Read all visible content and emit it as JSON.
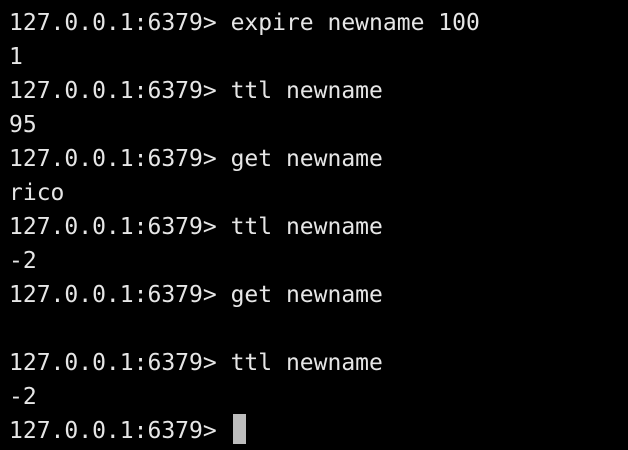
{
  "terminal": {
    "prompt": "127.0.0.1:6379> ",
    "lines": [
      {
        "type": "command",
        "text": "expire newname 100"
      },
      {
        "type": "output",
        "text": "1"
      },
      {
        "type": "command",
        "text": "ttl newname"
      },
      {
        "type": "output",
        "text": "95"
      },
      {
        "type": "command",
        "text": "get newname"
      },
      {
        "type": "output",
        "text": "rico"
      },
      {
        "type": "command",
        "text": "ttl newname"
      },
      {
        "type": "output",
        "text": "-2"
      },
      {
        "type": "command",
        "text": "get newname"
      },
      {
        "type": "output",
        "text": ""
      },
      {
        "type": "command",
        "text": "ttl newname"
      },
      {
        "type": "output",
        "text": "-2"
      }
    ],
    "current_input": ""
  },
  "colors": {
    "background": "#000000",
    "text": "#e6e6e6",
    "cursor": "#bdbdbd"
  }
}
